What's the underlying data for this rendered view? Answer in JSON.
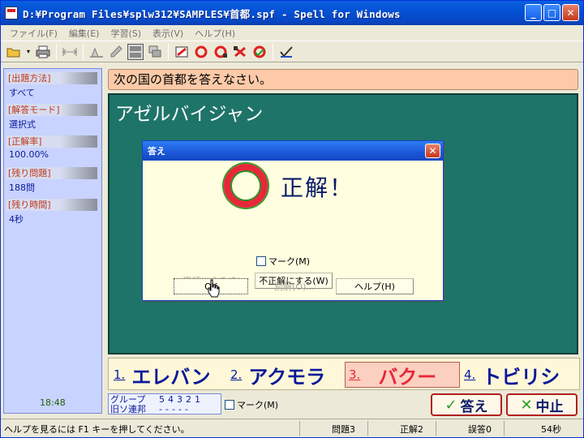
{
  "window": {
    "title": "D:¥Program Files¥splw312¥SAMPLES¥首都.spf - Spell for Windows",
    "controls": {
      "minimize": "_",
      "maximize": "□",
      "close": "✕"
    }
  },
  "menu": [
    "ファイル(F)",
    "編集(E)",
    "学習(S)",
    "表示(V)",
    "ヘルプ(H)"
  ],
  "toolbar": {
    "icons": [
      "open-folder-icon",
      "print-icon",
      "fit-width-icon",
      "pen-icon",
      "layout-split-icon",
      "layout-stack-icon",
      "study-1-icon",
      "study-2-icon",
      "study-3-icon",
      "study-4-icon",
      "study-5-icon",
      "check-mark-icon"
    ]
  },
  "stats": {
    "method_label": "[出題方法]",
    "method_value": "すべて",
    "mode_label": "[解答モード]",
    "mode_value": "選択式",
    "rate_label": "[正解率]",
    "rate_value": "100.00%",
    "remaining_label": "[残り問題]",
    "remaining_value": "188問",
    "time_label": "[残り時間]",
    "time_value": "4秒",
    "clock": "18:48"
  },
  "question": "次の国の首都を答えなさい。",
  "country": "アゼルバイジャン",
  "dialog": {
    "title": "答え",
    "close": "✕",
    "result": "正解！",
    "mark_label": "マーク(M)",
    "btn_make_correct": "正解にする(R)",
    "btn_make_incorrect": "不正解にする(W)",
    "btn_ok": "OK",
    "btn_alt": "別解(O)...",
    "btn_help": "ヘルプ(H)"
  },
  "choices": [
    {
      "num": "1.",
      "text": "エレバン"
    },
    {
      "num": "2.",
      "text": "アクモラ"
    },
    {
      "num": "3.",
      "text": "バクー"
    },
    {
      "num": "4.",
      "text": "トビリシ"
    }
  ],
  "group": {
    "label1": "グループ",
    "label2": "旧ソ連邦",
    "digits": "54321",
    "dashes": "-----"
  },
  "bottom_mark_label": "マーク(M)",
  "buttons": {
    "answer": "答え",
    "answer_mark": "✓",
    "stop": "中止",
    "stop_mark": "✕"
  },
  "statusbar": {
    "help": "ヘルプを見るには F1 キーを押してください。",
    "question_no": "問題3",
    "correct": "正解2",
    "wrong": "誤答0",
    "elapsed": "54秒"
  },
  "colors": {
    "accent_green": "#1e7468",
    "question_bg": "#fccaa8",
    "selected_red": "#e8283a",
    "text_blue": "#0a1a9a"
  }
}
